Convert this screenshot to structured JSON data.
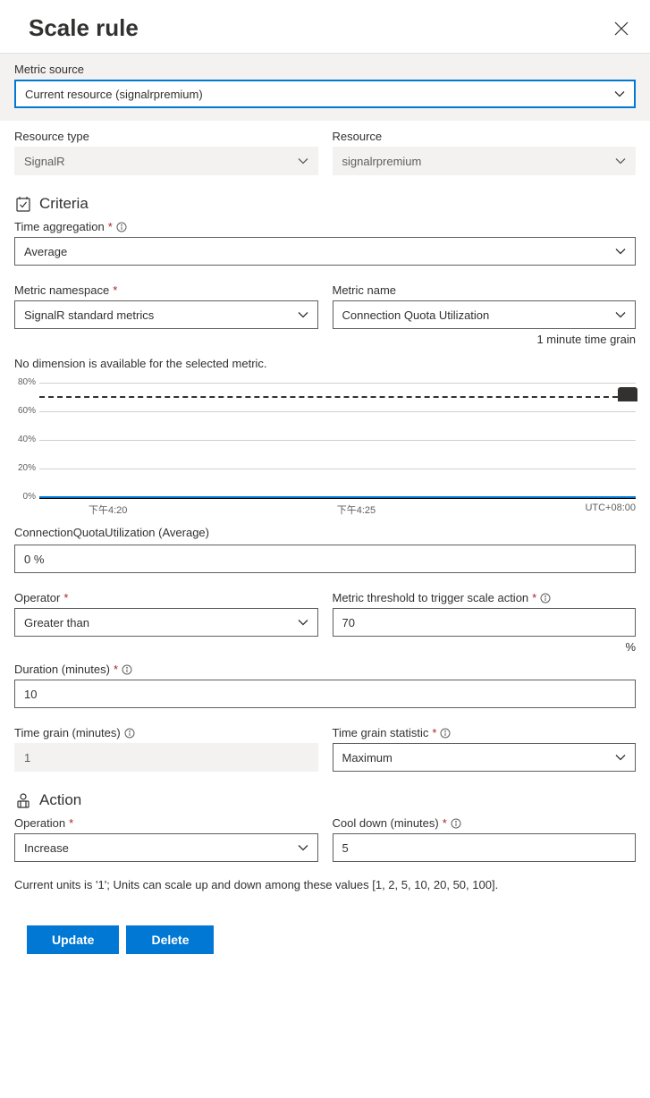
{
  "header": {
    "title": "Scale rule"
  },
  "metricSource": {
    "label": "Metric source",
    "value": "Current resource (signalrpremium)"
  },
  "resourceType": {
    "label": "Resource type",
    "value": "SignalR"
  },
  "resource": {
    "label": "Resource",
    "value": "signalrpremium"
  },
  "criteria": {
    "title": "Criteria",
    "timeAggregation": {
      "label": "Time aggregation",
      "value": "Average"
    },
    "metricNamespace": {
      "label": "Metric namespace",
      "value": "SignalR standard metrics"
    },
    "metricName": {
      "label": "Metric name",
      "value": "Connection Quota Utilization",
      "note": "1 minute time grain"
    },
    "noDimension": "No dimension is available for the selected metric."
  },
  "chart_data": {
    "type": "line",
    "title": "ConnectionQuotaUtilization (Average)",
    "ylabel": "%",
    "ylim": [
      0,
      80
    ],
    "yticks": [
      "0%",
      "20%",
      "40%",
      "60%",
      "80%"
    ],
    "threshold": 70,
    "x": [
      "下午4:20",
      "下午4:25"
    ],
    "values": [
      0,
      0
    ],
    "bump_value": 80,
    "tz": "UTC+08:00"
  },
  "connectionQuota": {
    "label": "ConnectionQuotaUtilization (Average)",
    "value": "0 %"
  },
  "operator": {
    "label": "Operator",
    "value": "Greater than"
  },
  "threshold": {
    "label": "Metric threshold to trigger scale action",
    "value": "70",
    "unit": "%"
  },
  "duration": {
    "label": "Duration (minutes)",
    "value": "10"
  },
  "timeGrain": {
    "label": "Time grain (minutes)",
    "value": "1"
  },
  "timeGrainStat": {
    "label": "Time grain statistic",
    "value": "Maximum"
  },
  "action": {
    "title": "Action",
    "operation": {
      "label": "Operation",
      "value": "Increase"
    },
    "cooldown": {
      "label": "Cool down (minutes)",
      "value": "5"
    }
  },
  "unitsNote": "Current units is '1'; Units can scale up and down among these values [1, 2, 5, 10, 20, 50, 100].",
  "buttons": {
    "update": "Update",
    "delete": "Delete"
  }
}
